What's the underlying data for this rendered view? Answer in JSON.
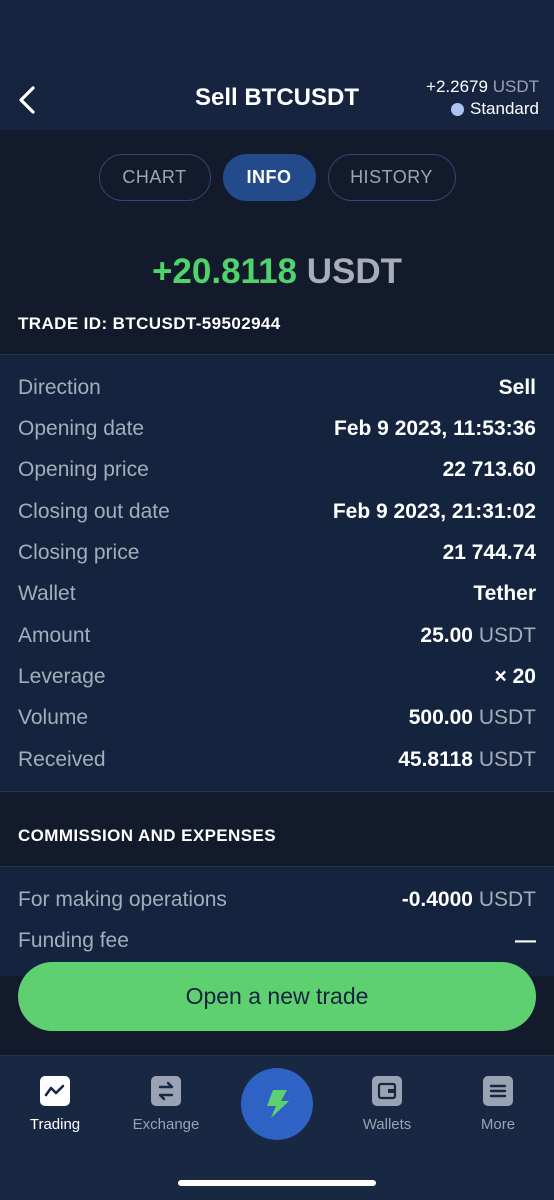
{
  "header": {
    "title": "Sell BTCUSDT",
    "pnl_value": "+2.2679",
    "pnl_unit": "USDT",
    "account": "Standard"
  },
  "tabs": [
    {
      "label": "CHART",
      "active": false
    },
    {
      "label": "INFO",
      "active": true
    },
    {
      "label": "HISTORY",
      "active": false
    }
  ],
  "profit": {
    "value": "+20.8118",
    "unit": "USDT"
  },
  "trade_id": "TRADE ID: BTCUSDT-59502944",
  "details": [
    {
      "label": "Direction",
      "value": "Sell",
      "unit": ""
    },
    {
      "label": "Opening date",
      "value": "Feb 9 2023, 11:53:36",
      "unit": ""
    },
    {
      "label": "Opening price",
      "value": "22 713.60",
      "unit": ""
    },
    {
      "label": "Closing out date",
      "value": "Feb 9 2023, 21:31:02",
      "unit": ""
    },
    {
      "label": "Closing price",
      "value": "21 744.74",
      "unit": ""
    },
    {
      "label": "Wallet",
      "value": "Tether",
      "unit": ""
    },
    {
      "label": "Amount",
      "value": "25.00",
      "unit": "USDT"
    },
    {
      "label": "Leverage",
      "value": "× 20",
      "unit": ""
    },
    {
      "label": "Volume",
      "value": "500.00",
      "unit": "USDT"
    },
    {
      "label": "Received",
      "value": "45.8118",
      "unit": "USDT"
    }
  ],
  "commission": {
    "title": "COMMISSION AND EXPENSES",
    "rows": [
      {
        "label": "For making operations",
        "value": "-0.4000",
        "unit": "USDT"
      },
      {
        "label": "Funding fee",
        "value": "—",
        "unit": ""
      }
    ]
  },
  "open_button": "Open a new trade",
  "nav": [
    {
      "label": "Trading",
      "icon": "trading-chart-icon",
      "active": true
    },
    {
      "label": "Exchange",
      "icon": "exchange-arrows-icon",
      "active": false
    },
    {
      "label": "Wallets",
      "icon": "wallet-icon",
      "active": false
    },
    {
      "label": "More",
      "icon": "menu-lines-icon",
      "active": false
    }
  ],
  "colors": {
    "profit": "#4fd46b",
    "accent": "#2e63c5",
    "button": "#5fd070",
    "background": "#121a2c"
  }
}
